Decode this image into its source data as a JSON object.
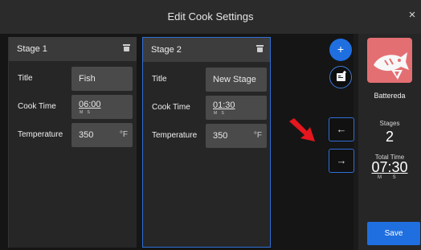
{
  "window": {
    "title": "Edit Cook Settings",
    "close_glyph": "×",
    "close_icon": "close-icon"
  },
  "stages": [
    {
      "name": "Stage 1",
      "title_label": "Title",
      "title_value": "Fish",
      "cook_time_label": "Cook Time",
      "cook_time_value": "06:00",
      "cook_time_sub": "M S",
      "temp_label": "Temperature",
      "temp_value": "350",
      "temp_unit": "°F",
      "selected": false
    },
    {
      "name": "Stage 2",
      "title_label": "Title",
      "title_value": "New Stage",
      "cook_time_label": "Cook Time",
      "cook_time_value": "01:30",
      "cook_time_sub": "M S",
      "temp_label": "Temperature",
      "temp_value": "350",
      "temp_unit": "°F",
      "selected": true
    }
  ],
  "rail": {
    "add_glyph": "+",
    "add_icon": "plus-icon",
    "note_icon": "edit-note-icon",
    "prev_glyph": "←",
    "prev_icon": "arrow-left-icon",
    "next_glyph": "→",
    "next_icon": "arrow-right-icon"
  },
  "side": {
    "image_icon": "fish-icon",
    "recipe_name": "Battereda",
    "stages_label": "Stages",
    "stages_value": "2",
    "total_label": "Total Time",
    "total_value": "07:30",
    "total_sub": "M S",
    "save_label": "Save"
  },
  "colors": {
    "accent": "#1f6fe0",
    "annotation_arrow": "#e5161d",
    "thumbnail_bg": "#e36f73"
  }
}
